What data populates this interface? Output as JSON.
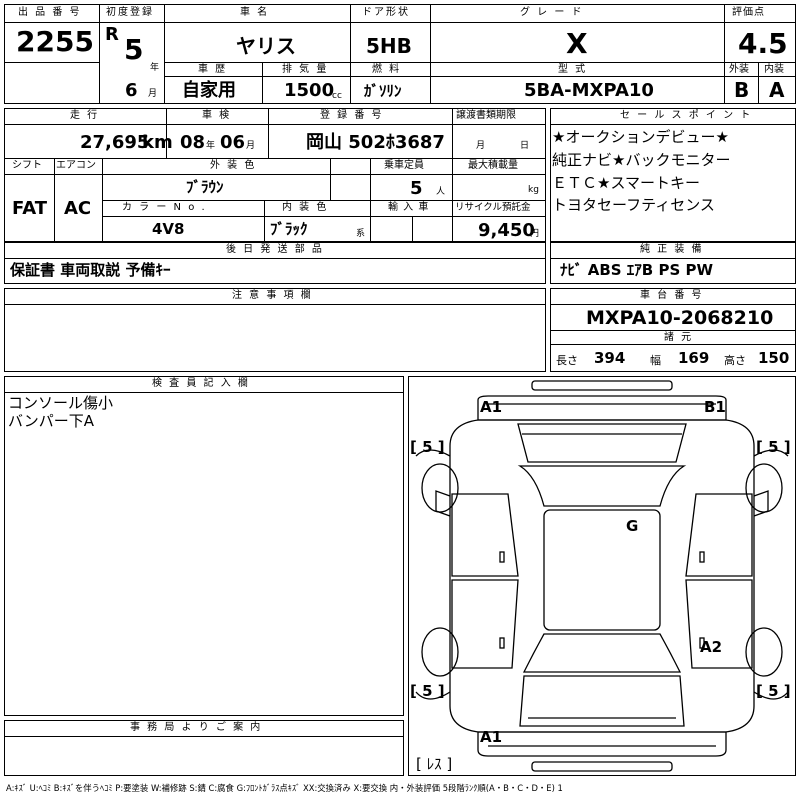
{
  "header": {
    "lot_no_label": "出 品 番 号",
    "lot_no": "2255",
    "first_reg_label": "初度登録",
    "era_letter": "R",
    "reg_year": "5",
    "year_unit": "年",
    "reg_month": "6",
    "month_unit": "月",
    "car_name_label": "車 名",
    "car_name": "ヤリス",
    "door_label": "ドア形状",
    "door": "5HB",
    "grade_label": "グ レ ー ド",
    "grade": "X",
    "score_label": "評価点",
    "score": "4.5",
    "history_label": "車 歴",
    "history": "自家用",
    "displacement_label": "排 気 量",
    "displacement": "1500",
    "cc_unit": "cc",
    "fuel_label": "燃 料",
    "fuel": "ｶﾞｿﾘﾝ",
    "model_label": "型 式",
    "model": "5BA-MXPA10",
    "exterior_label": "外装",
    "exterior": "B",
    "interior_label": "内装",
    "interior": "A"
  },
  "row2": {
    "mileage_label": "走 行",
    "mileage": "27,695",
    "km_unit": "km",
    "inspection_label": "車 検",
    "insp_year": "08",
    "insp_year_unit": "年",
    "insp_month": "06",
    "insp_month_unit": "月",
    "plate_label": "登 録 番 号",
    "plate": "岡山 502ﾎ3687",
    "transfer_label": "譲渡書類期限",
    "transfer_month_unit": "月",
    "transfer_day_unit": "日",
    "shift_label": "シフト",
    "shift": "FAT",
    "ac_label": "エアコン",
    "ac": "AC",
    "ext_color_label": "外 装 色",
    "ext_color": "ﾌﾞﾗｳﾝ",
    "capacity_label": "乗車定員",
    "capacity": "5",
    "capacity_unit": "人",
    "load_label": "最大積載量",
    "load_unit": "kg",
    "color_no_label": "カ ラ ー  N o .",
    "color_no": "4V8",
    "int_color_label": "内 装 色",
    "int_color": "ﾌﾞﾗｯｸ",
    "int_color_unit": "系",
    "import_label": "輸 入 車",
    "recycle_label": "リサイクル預託金",
    "recycle": "9,450",
    "recycle_unit": "円"
  },
  "sales_points": {
    "label": "セ ー ル ス ポ イ ン ト",
    "lines": [
      "★オークションデビュー★",
      "純正ナビ★バックモニター",
      "ＥＴＣ★スマートキー",
      "トヨタセーフティセンス"
    ]
  },
  "docs": {
    "label": "後 日 発 送 部 品",
    "value": "保証書 車両取説 予備ｷｰ"
  },
  "equipment": {
    "label": "純 正 装 備",
    "value": "ﾅﾋﾞ ABS ｴｱB PS PW"
  },
  "notes": {
    "label": "注 意 事 項 欄"
  },
  "chassis": {
    "label": "車 台 番 号",
    "value": "MXPA10-2068210",
    "dims_label": "諸 元",
    "length_label": "長さ",
    "length": "394",
    "width_label": "幅",
    "width": "169",
    "height_label": "高さ",
    "height": "150"
  },
  "inspector": {
    "label": "検 査 員 記 入 欄",
    "lines": [
      "コンソール傷小",
      "バンパー下A"
    ]
  },
  "office": {
    "label": "事 務 局 よ り ご 案 内"
  },
  "diagram": {
    "a1_top": "A1",
    "b1": "B1",
    "g": "G",
    "a2": "A2",
    "a1_bottom": "A1",
    "tire_fl": "[ 5 ]",
    "tire_fr": "[ 5 ]",
    "tire_rl": "[ 5 ]",
    "tire_rr": "[ 5 ]",
    "spare": "[ ﾚｽ ]"
  },
  "footer": {
    "legend": "A:ｷｽﾞ U:ﾍｺﾐ B:ｷｽﾞを伴うﾍｺﾐ P:要塗装 W:補修跡 S:錆 C:腐食 G:ﾌﾛﾝﾄｶﾞﾗｽ点ｷｽﾞ XX:交換済み X:要交換 内・外装評価 5段階ﾗﾝｸ順(A・B・C・D・E) 1"
  }
}
